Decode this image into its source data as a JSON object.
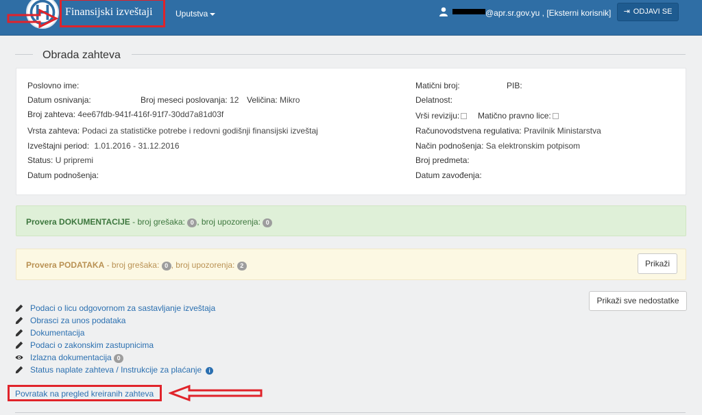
{
  "navbar": {
    "app_title": "Finansijski izveštaji",
    "menu_label": "Uputstva",
    "user_text": "@apr.sr.gov.yu , [Eksterni korisnik]",
    "logout_label": "ODJAVI SE",
    "bg_color": "#2f6ea5"
  },
  "section": {
    "title": "Obrada zahteva"
  },
  "info": {
    "poslovno_ime_label": "Poslovno ime:",
    "datum_osnivanja_label": "Datum osnivanja:",
    "broj_meseci_label": "Broj meseci poslovanja:",
    "broj_meseci_value": "12",
    "velicina_label": "Veličina:",
    "velicina_value": "Mikro",
    "broj_zahteva_label": "Broj zahteva:",
    "broj_zahteva_value": "4ee67fdb-941f-416f-91f7-30dd7a81d03f",
    "vrsta_zahteva_label": "Vrsta zahteva:",
    "vrsta_zahteva_value": "Podaci za statističke potrebe i redovni godišnji finansijski izveštaj",
    "izvestajni_period_label": "Izveštajni period:",
    "izvestajni_period_value": "1.01.2016 - 31.12.2016",
    "status_label": "Status:",
    "status_value": "U pripremi",
    "datum_podnosenja_label": "Datum podnošenja:",
    "maticni_broj_label": "Matični broj:",
    "pib_label": "PIB:",
    "delatnost_label": "Delatnost:",
    "vrsi_reviziju_label": "Vrši reviziju:",
    "maticno_pravno_lice_label": "Matično pravno lice:",
    "racunovodstvena_label": "Računovodstvena regulativa:",
    "racunovodstvena_value": "Pravilnik Ministarstva",
    "nacin_podnosenja_label": "Način podnošenja:",
    "nacin_podnosenja_value": "Sa elektronskim potpisom",
    "broj_predmeta_label": "Broj predmeta:",
    "datum_zavodjenja_label": "Datum zavođenja:"
  },
  "alerts": {
    "dokumentacija": {
      "title": "Provera DOKUMENTACIJE",
      "errors_label": " - broj grešaka:",
      "errors_count": "0",
      "warnings_label": ", broj upozorenja:",
      "warnings_count": "0"
    },
    "podaci": {
      "title": "Provera PODATAKA",
      "errors_label": " - broj grešaka:",
      "errors_count": "0",
      "warnings_label": ", broj upozorenja:",
      "warnings_count": "2",
      "button_label": "Prikaži"
    }
  },
  "show_all_button": "Prikaži sve nedostatke",
  "links": [
    {
      "label": "Podaci o licu odgovornom za sastavljanje izveštaja",
      "icon": "pencil-icon"
    },
    {
      "label": "Obrasci za unos podataka",
      "icon": "pencil-icon"
    },
    {
      "label": "Dokumentacija",
      "icon": "pencil-icon"
    },
    {
      "label": "Podaci o zakonskim zastupnicima",
      "icon": "pencil-icon"
    },
    {
      "label": "Izlazna dokumentacija",
      "icon": "eye-icon",
      "badge": "0"
    },
    {
      "label": "Status naplate zahteva / Instrukcije za plaćanje",
      "icon": "pencil-icon",
      "info_icon": "i"
    }
  ],
  "back_link": "Povratak na pregled kreiranih zahteva",
  "colors": {
    "link": "#2a6fb0",
    "annotation_red": "#e0232a",
    "success_bg": "#dff0d8",
    "warning_bg": "#fcf8e3"
  }
}
